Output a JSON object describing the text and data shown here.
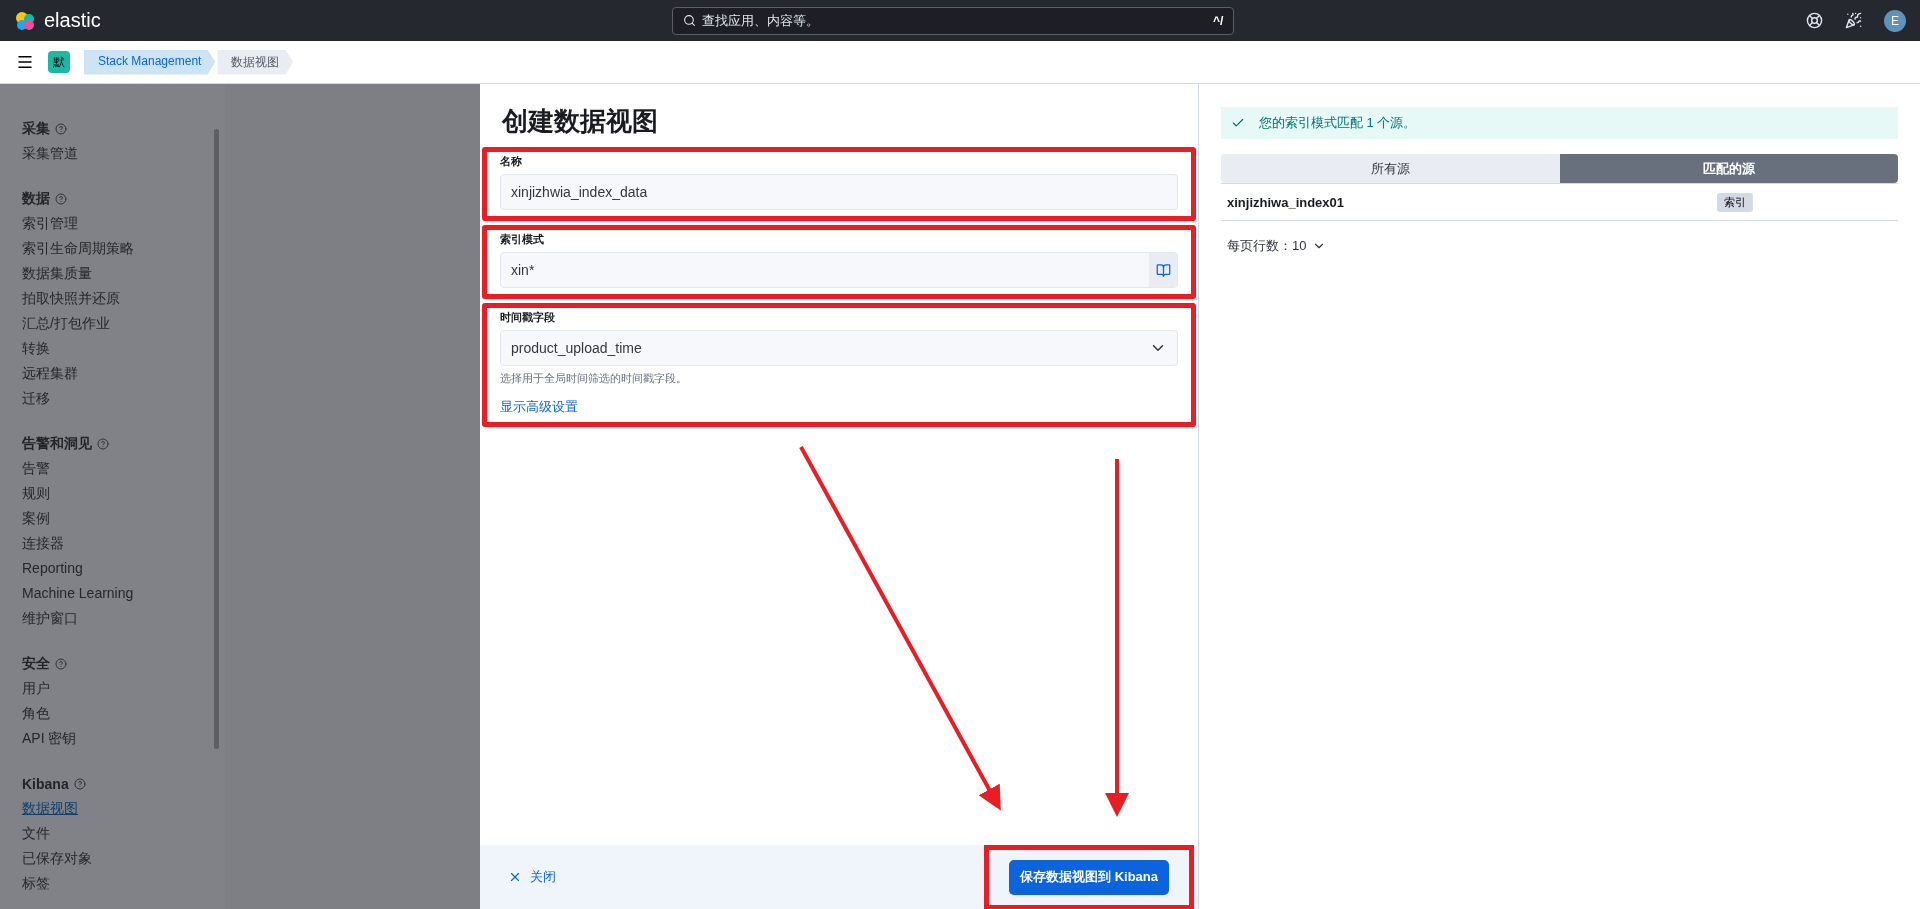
{
  "header": {
    "logo_text": "elastic",
    "search": {
      "placeholder": "查找应用、内容等。",
      "shortcut": "^/"
    },
    "avatar": "E"
  },
  "breadcrumb_bar": {
    "space": "默",
    "crumbs": [
      {
        "label": "Stack Management",
        "selected": false
      },
      {
        "label": "数据视图",
        "selected": true
      }
    ]
  },
  "sidebar": {
    "sections": [
      {
        "title": "采集",
        "items": [
          {
            "label": "采集管道",
            "selected": false
          }
        ]
      },
      {
        "title": "数据",
        "items": [
          {
            "label": "索引管理",
            "selected": false
          },
          {
            "label": "索引生命周期策略",
            "selected": false
          },
          {
            "label": "数据集质量",
            "selected": false
          },
          {
            "label": "拍取快照并还原",
            "selected": false
          },
          {
            "label": "汇总/打包作业",
            "selected": false
          },
          {
            "label": "转换",
            "selected": false
          },
          {
            "label": "远程集群",
            "selected": false
          },
          {
            "label": "迁移",
            "selected": false
          }
        ]
      },
      {
        "title": "告警和洞见",
        "items": [
          {
            "label": "告警",
            "selected": false
          },
          {
            "label": "规则",
            "selected": false
          },
          {
            "label": "案例",
            "selected": false
          },
          {
            "label": "连接器",
            "selected": false
          },
          {
            "label": "Reporting",
            "selected": false
          },
          {
            "label": "Machine Learning",
            "selected": false
          },
          {
            "label": "维护窗口",
            "selected": false
          }
        ]
      },
      {
        "title": "安全",
        "items": [
          {
            "label": "用户",
            "selected": false
          },
          {
            "label": "角色",
            "selected": false
          },
          {
            "label": "API 密钥",
            "selected": false
          }
        ]
      },
      {
        "title": "Kibana",
        "items": [
          {
            "label": "数据视图",
            "selected": true
          },
          {
            "label": "文件",
            "selected": false
          },
          {
            "label": "已保存对象",
            "selected": false
          },
          {
            "label": "标签",
            "selected": false
          }
        ]
      }
    ]
  },
  "flyout": {
    "title": "创建数据视图",
    "fields": [
      {
        "kind": "text",
        "label": "名称",
        "value": "xinjizhwia_index_data",
        "highlighted": true
      },
      {
        "kind": "pattern",
        "label": "索引模式",
        "value": "xin*",
        "highlighted": true
      },
      {
        "kind": "select",
        "label": "时间戳字段",
        "value": "product_upload_time",
        "help": "选择用于全局时间筛选的时间戳字段。",
        "link": "显示高级设置",
        "highlighted": true
      }
    ],
    "footer": {
      "close": "关闭",
      "save": "保存数据视图到 Kibana",
      "save_highlighted": true
    }
  },
  "preview": {
    "callout": "您的索引模式匹配 1 个源。",
    "tabs": [
      {
        "label": "所有源",
        "selected": false
      },
      {
        "label": "匹配的源",
        "selected": true
      }
    ],
    "rows": [
      {
        "name": "xinjizhiwa_index01",
        "badge": "索引"
      }
    ],
    "pagination": "每页行数：10"
  }
}
